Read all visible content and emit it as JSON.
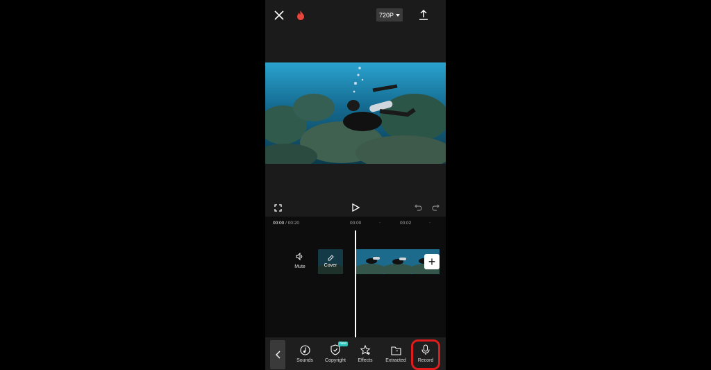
{
  "header": {
    "resolution": "720P"
  },
  "timeline": {
    "current_time": "00:00",
    "total_time": " / 00:20",
    "ruler_time_1": "00:00",
    "ruler_time_2": "00:02",
    "ruler_dot": "·",
    "mute_label": "Mute",
    "cover_label": "Cover",
    "add_symbol": "+"
  },
  "toolbar": {
    "items": [
      {
        "label": "Sounds",
        "icon": "music-note-icon"
      },
      {
        "label": "Copyright",
        "icon": "shield-check-icon",
        "badge": "New"
      },
      {
        "label": "Effects",
        "icon": "star-effects-icon"
      },
      {
        "label": "Extracted",
        "icon": "folder-icon"
      },
      {
        "label": "Record",
        "icon": "microphone-icon"
      }
    ]
  },
  "colors": {
    "highlight": "#e01b1b",
    "badge": "#2ac3b8",
    "flame": "#e8453c"
  }
}
